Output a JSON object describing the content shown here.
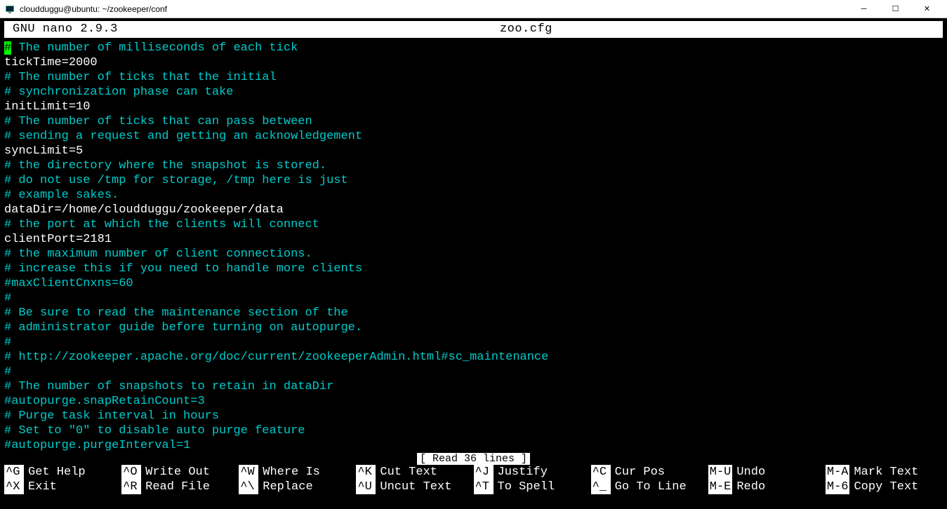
{
  "window": {
    "title": "cloudduggu@ubuntu: ~/zookeeper/conf"
  },
  "nano": {
    "version": "GNU nano 2.9.3",
    "filename": "zoo.cfg",
    "status": "[ Read 36 lines ]"
  },
  "lines": [
    {
      "type": "comment_first",
      "text": " The number of milliseconds of each tick"
    },
    {
      "type": "config",
      "text": "tickTime=2000"
    },
    {
      "type": "comment",
      "text": "# The number of ticks that the initial"
    },
    {
      "type": "comment",
      "text": "# synchronization phase can take"
    },
    {
      "type": "config",
      "text": "initLimit=10"
    },
    {
      "type": "comment",
      "text": "# The number of ticks that can pass between"
    },
    {
      "type": "comment",
      "text": "# sending a request and getting an acknowledgement"
    },
    {
      "type": "config",
      "text": "syncLimit=5"
    },
    {
      "type": "comment",
      "text": "# the directory where the snapshot is stored."
    },
    {
      "type": "comment",
      "text": "# do not use /tmp for storage, /tmp here is just"
    },
    {
      "type": "comment",
      "text": "# example sakes."
    },
    {
      "type": "config",
      "text": "dataDir=/home/cloudduggu/zookeeper/data"
    },
    {
      "type": "comment",
      "text": "# the port at which the clients will connect"
    },
    {
      "type": "config",
      "text": "clientPort=2181"
    },
    {
      "type": "comment",
      "text": "# the maximum number of client connections."
    },
    {
      "type": "comment",
      "text": "# increase this if you need to handle more clients"
    },
    {
      "type": "comment",
      "text": "#maxClientCnxns=60"
    },
    {
      "type": "comment",
      "text": "#"
    },
    {
      "type": "comment",
      "text": "# Be sure to read the maintenance section of the"
    },
    {
      "type": "comment",
      "text": "# administrator guide before turning on autopurge."
    },
    {
      "type": "comment",
      "text": "#"
    },
    {
      "type": "comment",
      "text": "# http://zookeeper.apache.org/doc/current/zookeeperAdmin.html#sc_maintenance"
    },
    {
      "type": "comment",
      "text": "#"
    },
    {
      "type": "comment",
      "text": "# The number of snapshots to retain in dataDir"
    },
    {
      "type": "comment",
      "text": "#autopurge.snapRetainCount=3"
    },
    {
      "type": "comment",
      "text": "# Purge task interval in hours"
    },
    {
      "type": "comment",
      "text": "# Set to \"0\" to disable auto purge feature"
    },
    {
      "type": "comment",
      "text": "#autopurge.purgeInterval=1"
    }
  ],
  "shortcuts": [
    {
      "key": "^G",
      "label": "Get Help"
    },
    {
      "key": "^O",
      "label": "Write Out"
    },
    {
      "key": "^W",
      "label": "Where Is"
    },
    {
      "key": "^K",
      "label": "Cut Text"
    },
    {
      "key": "^J",
      "label": "Justify"
    },
    {
      "key": "^C",
      "label": "Cur Pos"
    },
    {
      "key": "M-U",
      "label": "Undo"
    },
    {
      "key": "M-A",
      "label": "Mark Text"
    },
    {
      "key": "^X",
      "label": "Exit"
    },
    {
      "key": "^R",
      "label": "Read File"
    },
    {
      "key": "^\\",
      "label": "Replace"
    },
    {
      "key": "^U",
      "label": "Uncut Text"
    },
    {
      "key": "^T",
      "label": "To Spell"
    },
    {
      "key": "^_",
      "label": "Go To Line"
    },
    {
      "key": "M-E",
      "label": "Redo"
    },
    {
      "key": "M-6",
      "label": "Copy Text"
    }
  ]
}
